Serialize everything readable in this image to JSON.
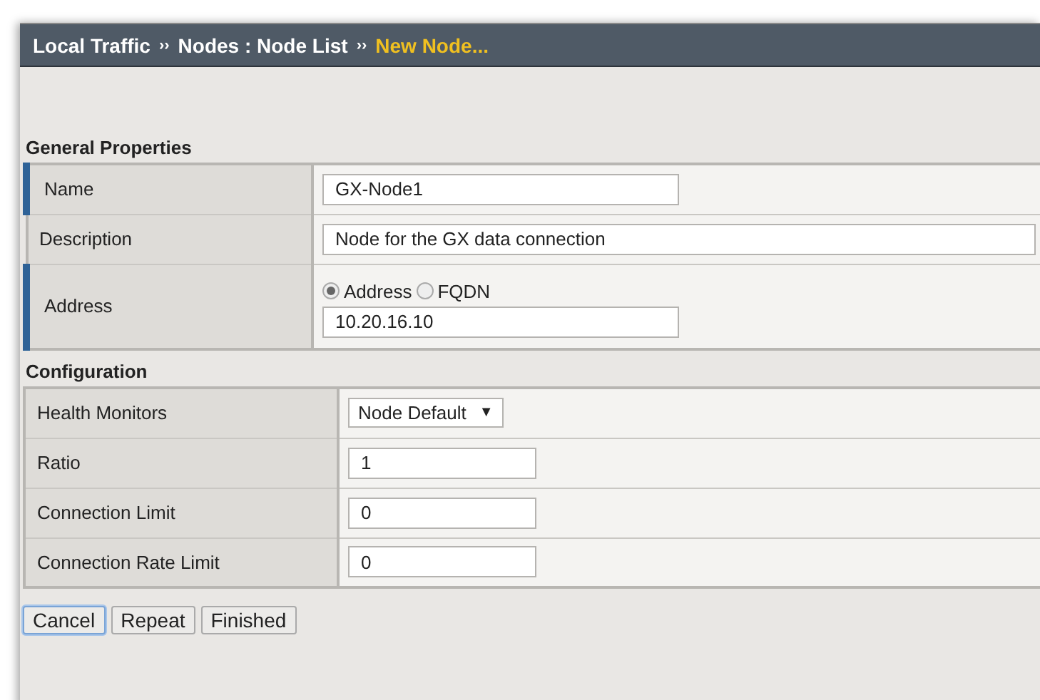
{
  "breadcrumb": [
    {
      "label": "Local Traffic",
      "current": false
    },
    {
      "label": "Nodes : Node List",
      "current": false
    },
    {
      "label": "New Node...",
      "current": true
    }
  ],
  "separator": "››",
  "sections": [
    {
      "title": "General Properties",
      "rows": [
        {
          "label": "Name",
          "required": true,
          "kind": "text",
          "value": "GX-Node1"
        },
        {
          "label": "Description",
          "required": false,
          "kind": "longtext",
          "value": "Node for the GX data connection"
        },
        {
          "label": "Address",
          "required": true,
          "kind": "address",
          "options": [
            {
              "label": "Address",
              "selected": true
            },
            {
              "label": "FQDN",
              "selected": false
            }
          ],
          "value": "10.20.16.10"
        }
      ]
    },
    {
      "title": "Configuration",
      "rows": [
        {
          "label": "Health Monitors",
          "required": false,
          "kind": "select",
          "value": "Node Default",
          "arrow": "▼"
        },
        {
          "label": "Ratio",
          "required": false,
          "kind": "text",
          "value": "1"
        },
        {
          "label": "Connection Limit",
          "required": false,
          "kind": "text",
          "value": "0"
        },
        {
          "label": "Connection Rate Limit",
          "required": false,
          "kind": "text",
          "value": "0"
        }
      ]
    }
  ],
  "buttons": [
    {
      "label": "Cancel",
      "focused": true
    },
    {
      "label": "Repeat",
      "focused": false
    },
    {
      "label": "Finished",
      "focused": false
    }
  ]
}
